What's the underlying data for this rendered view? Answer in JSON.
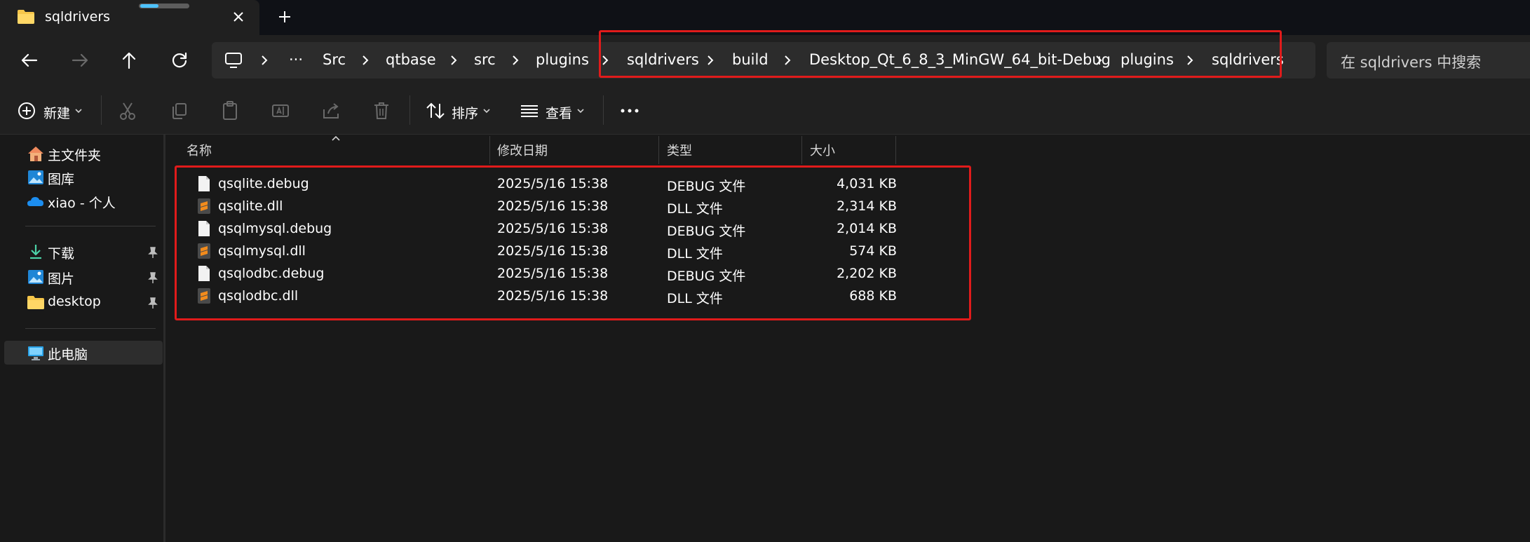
{
  "tab": {
    "title": "sqldrivers"
  },
  "address": {
    "overflow": "···",
    "crumbs": [
      "Src",
      "qtbase",
      "src",
      "plugins",
      "sqldrivers",
      "build",
      "Desktop_Qt_6_8_3_MinGW_64_bit-Debug",
      "plugins",
      "sqldrivers"
    ]
  },
  "search": {
    "placeholder": "在 sqldrivers 中搜索"
  },
  "toolbar": {
    "new_label": "新建",
    "sort_label": "排序",
    "view_label": "查看",
    "more_label": "···"
  },
  "sidebar": {
    "items": [
      {
        "label": "主文件夹",
        "icon": "home-icon"
      },
      {
        "label": "图库",
        "icon": "gallery-icon"
      },
      {
        "label": "xiao - 个人",
        "icon": "onedrive-cloud-icon"
      },
      {
        "label": "下载",
        "icon": "download-icon",
        "pinned": true
      },
      {
        "label": "图片",
        "icon": "pictures-icon",
        "pinned": true
      },
      {
        "label": "desktop",
        "icon": "folder-icon",
        "pinned": true
      },
      {
        "label": "此电脑",
        "icon": "this-pc-icon",
        "selected": true
      }
    ]
  },
  "columns": {
    "name": "名称",
    "modified": "修改日期",
    "type": "类型",
    "size": "大小"
  },
  "files": [
    {
      "name": "qsqlite.debug",
      "modified": "2025/5/16 15:38",
      "type": "DEBUG 文件",
      "size": "4,031 KB",
      "icon": "blank-file-icon"
    },
    {
      "name": "qsqlite.dll",
      "modified": "2025/5/16 15:38",
      "type": "DLL 文件",
      "size": "2,314 KB",
      "icon": "sublime-file-icon"
    },
    {
      "name": "qsqlmysql.debug",
      "modified": "2025/5/16 15:38",
      "type": "DEBUG 文件",
      "size": "2,014 KB",
      "icon": "blank-file-icon"
    },
    {
      "name": "qsqlmysql.dll",
      "modified": "2025/5/16 15:38",
      "type": "DLL 文件",
      "size": "574 KB",
      "icon": "sublime-file-icon"
    },
    {
      "name": "qsqlodbc.debug",
      "modified": "2025/5/16 15:38",
      "type": "DEBUG 文件",
      "size": "2,202 KB",
      "icon": "blank-file-icon"
    },
    {
      "name": "qsqlodbc.dll",
      "modified": "2025/5/16 15:38",
      "type": "DLL 文件",
      "size": "688 KB",
      "icon": "sublime-file-icon"
    }
  ],
  "colors": {
    "highlight": "#e01b1b",
    "accent": "#4cc2ff",
    "folder": "#f6c64a",
    "sublime": "#f28b1c"
  }
}
